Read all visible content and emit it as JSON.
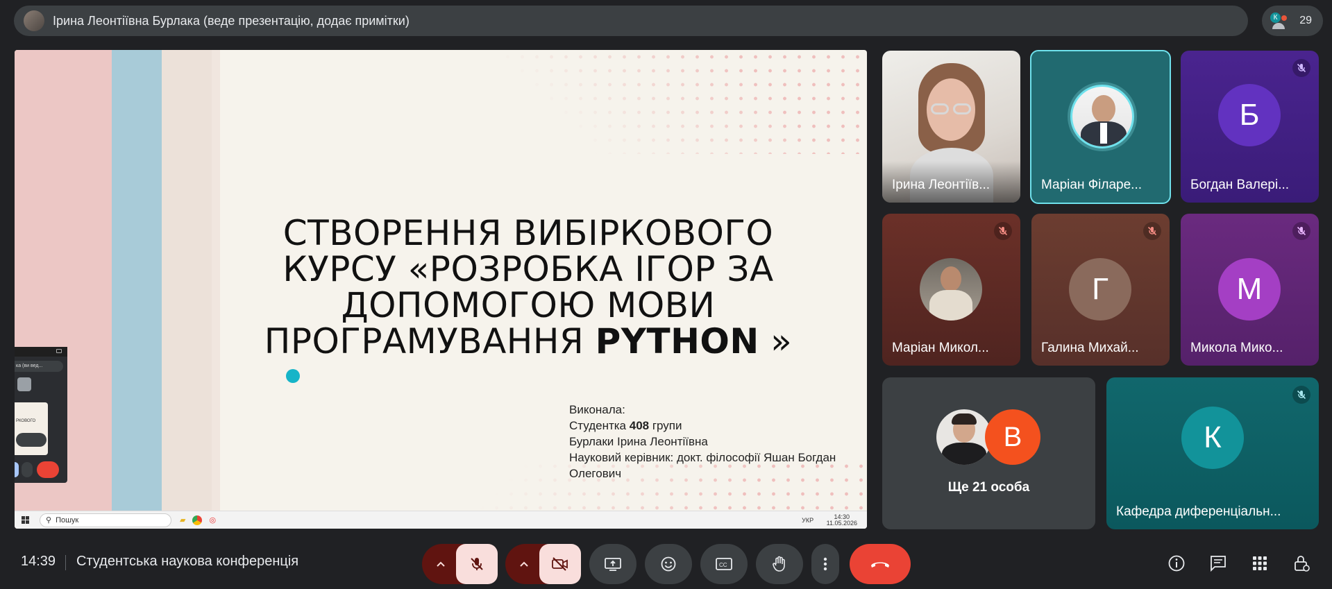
{
  "presenter_bar": {
    "text": "Ірина Леонтіївна Бурлака (веде презентацію, додає примітки)"
  },
  "people": {
    "count": "29",
    "mini_letter": "К"
  },
  "slide": {
    "title_line1": "СТВОРЕННЯ ВИБІРКОВОГО",
    "title_line2": "КУРСУ «РОЗРОБКА ІГОР ЗА",
    "title_line3": "ДОПОМОГОЮ МОВИ",
    "title_line4_a": "ПРОГРАМУВАННЯ ",
    "title_line4_b": "PYTHON",
    "title_line4_c": " »",
    "info_label": "Виконала:",
    "info_student_a": "Студентка ",
    "info_student_b": "408",
    "info_student_c": " групи",
    "info_name": "Бурлаки Ірина Леонтіївна",
    "info_supervisor_1": "Науковий керівник: докт. філософії Яшан Богдан",
    "info_supervisor_2": "Олегович",
    "taskbar_search": "Пошук",
    "tray_lang": "УКР",
    "tray_time": "14:30",
    "tray_date": "11.05.2026",
    "mini_window_label": "ка (ви вед..."
  },
  "tiles": [
    {
      "name": "Ірина Леонтіїв...",
      "type": "video"
    },
    {
      "name": "Маріан Філаре...",
      "type": "photo",
      "active": true
    },
    {
      "name": "Богдан Валері...",
      "letter": "Б",
      "color": "#5b2bb0",
      "muted": true
    },
    {
      "name": "Маріан Микол...",
      "type": "photo",
      "muted": true
    },
    {
      "name": "Галина Михай...",
      "letter": "Г",
      "color": "#8a6a5c",
      "muted": true
    },
    {
      "name": "Микола Мико...",
      "letter": "М",
      "color": "#a43fc4",
      "muted": true
    },
    {
      "name": "Ще 21 особа",
      "letter": "В"
    },
    {
      "name": "Кафедра диференціальн...",
      "letter": "К",
      "muted": true
    }
  ],
  "footer": {
    "time": "14:39",
    "meeting_title": "Студентська наукова конференція"
  },
  "colors": {
    "background": "#202124",
    "muted_red": "#f9dedc",
    "hangup": "#ea4335",
    "active_border": "#6fe1ec"
  }
}
